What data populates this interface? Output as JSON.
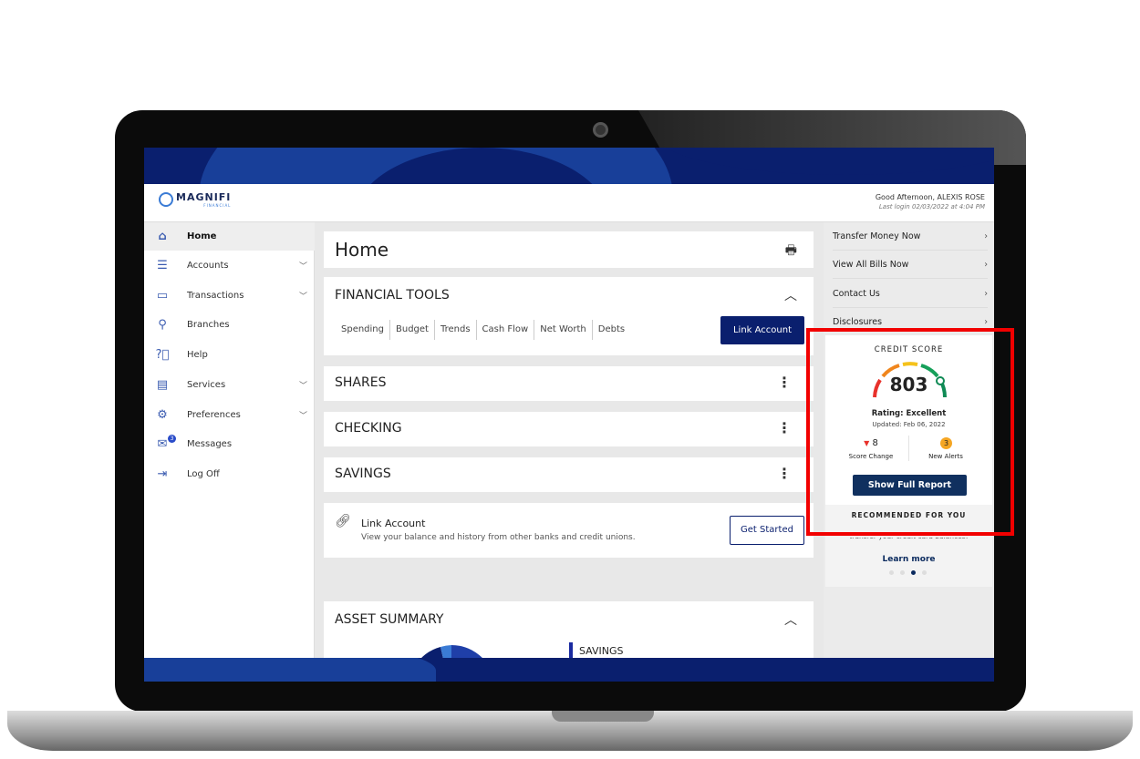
{
  "app": {
    "brand": "MAGNIFI",
    "brand_sub": "FINANCIAL",
    "greeting": "Good Afternoon, ALEXIS ROSE",
    "last_login": "Last login 02/03/2022 at 4:04 PM"
  },
  "sidebar": {
    "items": [
      {
        "label": "Home",
        "icon": "home-icon",
        "active": true
      },
      {
        "label": "Accounts",
        "icon": "list-icon",
        "chevron": true
      },
      {
        "label": "Transactions",
        "icon": "credit-card-icon",
        "chevron": true
      },
      {
        "label": "Branches",
        "icon": "location-pin-icon"
      },
      {
        "label": "Help",
        "icon": "help-icon"
      },
      {
        "label": "Services",
        "icon": "calculator-icon",
        "chevron": true
      },
      {
        "label": "Preferences",
        "icon": "gear-icon",
        "chevron": true
      },
      {
        "label": "Messages",
        "icon": "mail-icon",
        "badge": "3"
      },
      {
        "label": "Log Off",
        "icon": "logout-icon"
      }
    ]
  },
  "main": {
    "page_title": "Home",
    "financial_tools": {
      "title": "FINANCIAL TOOLS",
      "tabs": [
        "Spending",
        "Budget",
        "Trends",
        "Cash Flow",
        "Net Worth",
        "Debts"
      ],
      "link_button": "Link Account"
    },
    "sections": [
      "SHARES",
      "CHECKING",
      "SAVINGS"
    ],
    "link_account": {
      "title": "Link Account",
      "description": "View your balance and history from other banks and credit unions.",
      "button": "Get Started"
    },
    "asset_summary": {
      "title": "ASSET SUMMARY",
      "legend_label": "SAVINGS"
    }
  },
  "right": {
    "links": [
      "Transfer Money Now",
      "View All Bills Now",
      "Contact Us",
      "Disclosures"
    ],
    "credit_score": {
      "title": "CREDIT SCORE",
      "score": "803",
      "rating": "Rating: Excellent",
      "updated": "Updated: Feb 06, 2022",
      "score_change": "8",
      "score_change_label": "Score Change",
      "alerts": "3",
      "alerts_label": "New Alerts",
      "button": "Show Full Report"
    },
    "recommended": {
      "title": "RECOMMENDED FOR YOU",
      "text": "transfer your credit card balances!",
      "link": "Learn more",
      "carousel_active": 3,
      "carousel_total": 4
    }
  },
  "colors": {
    "brand": "#0a1f6e",
    "accent": "#3a7bd5",
    "highlight": "#f20000"
  }
}
